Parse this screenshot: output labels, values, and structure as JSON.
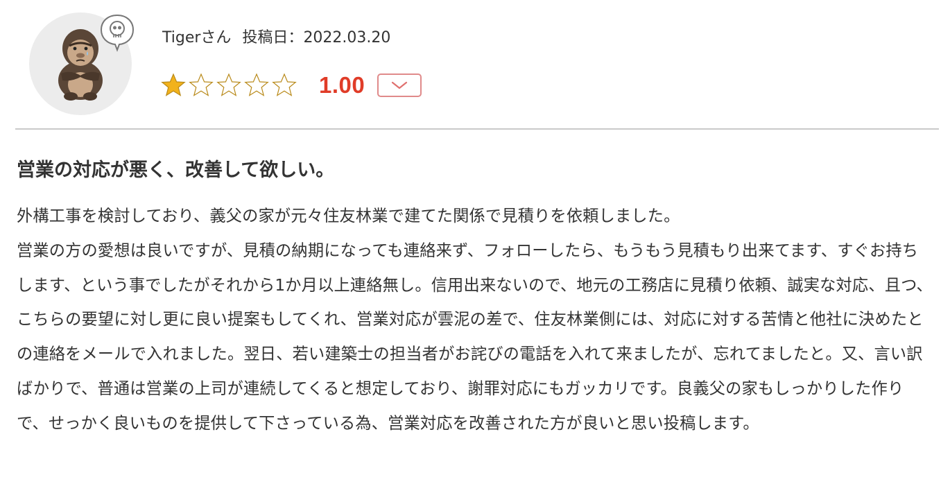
{
  "reviewer": {
    "avatar_icon": "gorilla-avatar-icon",
    "badge_icon": "skull-icon",
    "name": "Tigerさん",
    "posted_label": "投稿日：",
    "posted_date": "2022.03.20"
  },
  "rating": {
    "score": "1.00",
    "stars_filled": 1,
    "stars_total": 5,
    "star_color": "#f2b21c",
    "score_color": "#e03c28",
    "expand_icon": "chevron-down-icon"
  },
  "review": {
    "title": "営業の対応が悪く、改善して欲しい。",
    "paragraphs": [
      "外構工事を検討しており、義父の家が元々住友林業で建てた関係で見積りを依頼しました。",
      "営業の方の愛想は良いですが、見積の納期になっても連絡来ず、フォローしたら、もうもう見積もり出来てます、すぐお持ちします、という事でしたがそれから1か月以上連絡無し。信用出来ないので、地元の工務店に見積り依頼、誠実な対応、且つ、こちらの要望に対し更に良い提案もしてくれ、営業対応が雲泥の差で、住友林業側には、対応に対する苦情と他社に決めたとの連絡をメールで入れました。翌日、若い建築士の担当者がお詫びの電話を入れて来ましたが、忘れてましたと。又、言い訳ばかりで、普通は営業の上司が連続してくると想定しており、謝罪対応にもガッカリです。良義父の家もしっかりした作りで、せっかく良いものを提供して下さっている為、営業対応を改善された方が良いと思い投稿します。"
    ]
  }
}
